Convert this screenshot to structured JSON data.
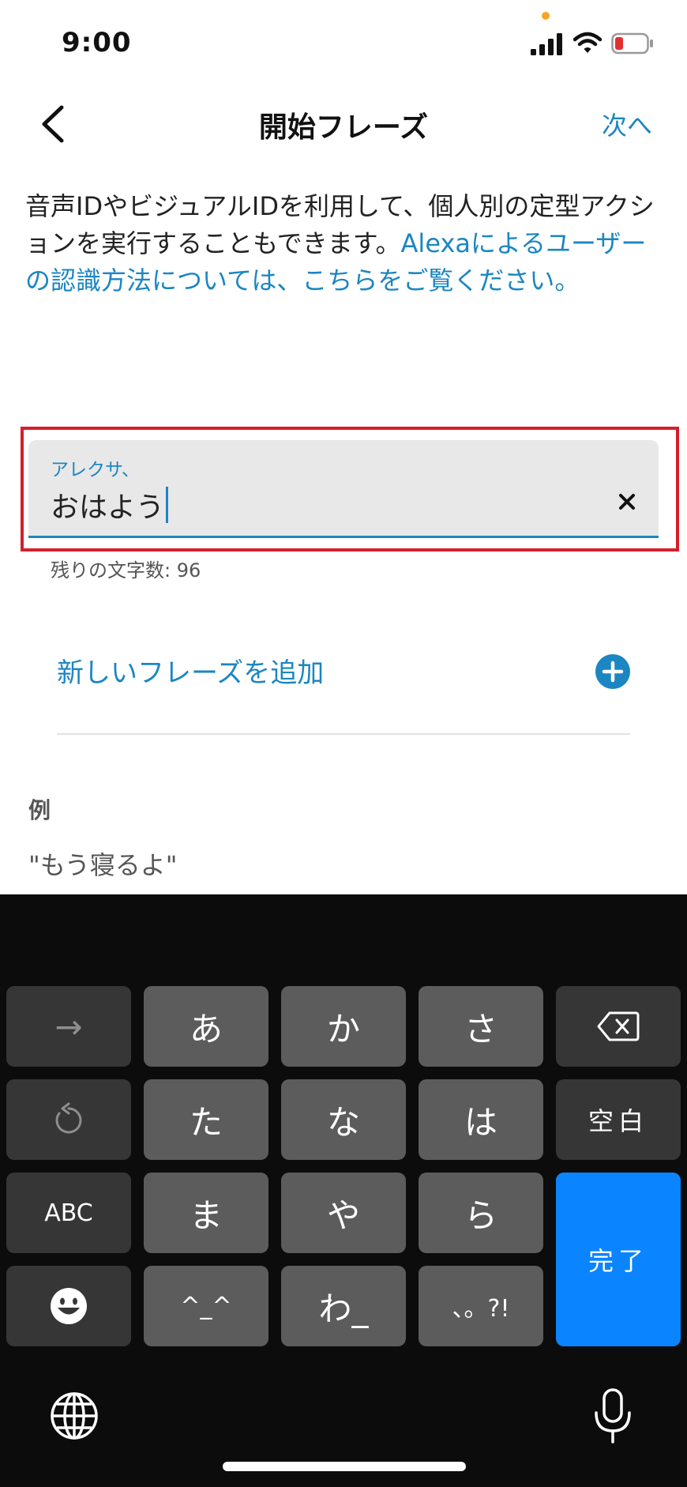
{
  "status_bar": {
    "time": "9:00",
    "icons": [
      "orange-dot",
      "signal-icon",
      "wifi-icon",
      "battery-low-icon"
    ],
    "colors": {
      "battery_low": "#e23030",
      "dot": "#f5a623"
    }
  },
  "nav": {
    "back_icon": "chevron-left-icon",
    "title": "開始フレーズ",
    "next_label": "次へ"
  },
  "description": {
    "text": "音声IDやビジュアルIDを利用して、個人別の定型アクションを実行することもできます。",
    "link_text": "Alexaによるユーザーの認識方法については、こちらをご覧ください。"
  },
  "phrase_field": {
    "label": "アレクサ、",
    "value": "おはよう",
    "clear_icon": "close-icon",
    "counter": "残りの文字数: 96"
  },
  "add_phrase": {
    "label": "新しいフレーズを追加",
    "icon": "plus-circle-icon"
  },
  "example": {
    "title": "例",
    "text": "\"もう寝るよ\""
  },
  "keyboard": {
    "keys": {
      "arrow": "→",
      "a": "あ",
      "ka": "か",
      "sa": "さ",
      "ta": "た",
      "na": "な",
      "ha": "は",
      "space": "空白",
      "abc": "ABC",
      "ma": "ま",
      "ya": "や",
      "ra": "ら",
      "done": "完了",
      "kaomoji": "^_^",
      "wa": "わ_",
      "punct": "、。?!"
    },
    "icons": [
      "delete-icon",
      "undo-icon",
      "emoji-icon",
      "globe-icon",
      "microphone-icon"
    ],
    "colors": {
      "done_key": "#0a84ff",
      "accent": "#1b86c2"
    }
  }
}
